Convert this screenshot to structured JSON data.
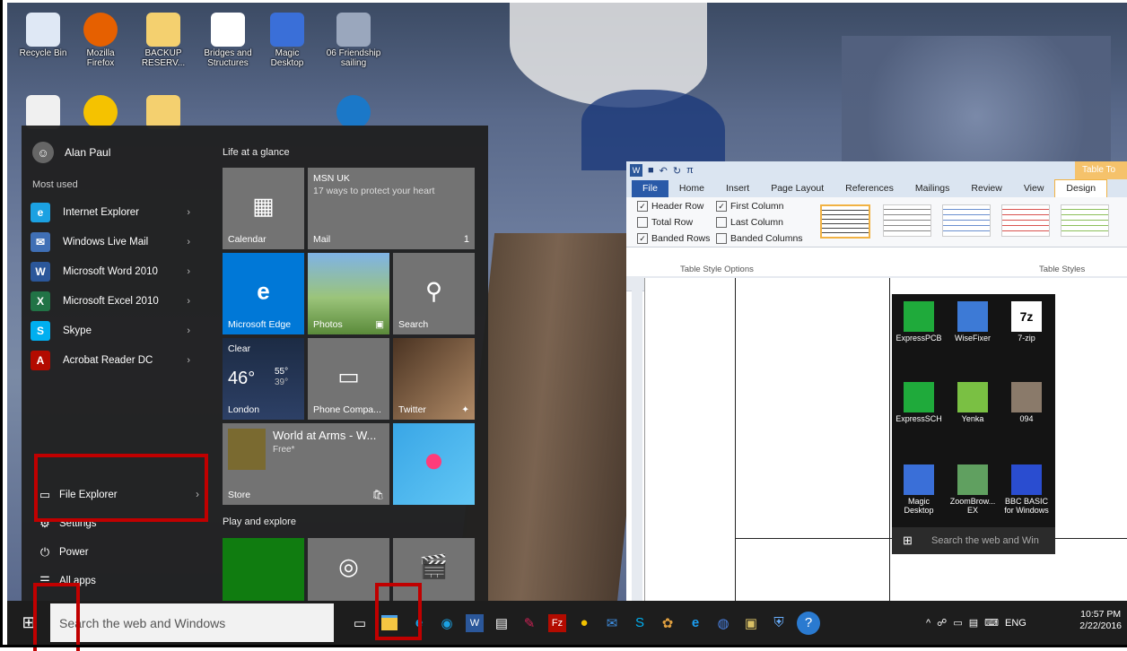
{
  "desktop": {
    "icons": [
      {
        "label": "Recycle Bin",
        "icon": "recycle-bin-icon",
        "color": "#dfe8f5"
      },
      {
        "label": "Mozilla Firefox",
        "icon": "firefox-icon",
        "color": "#e66000"
      },
      {
        "label": "BACKUP RESERV...",
        "icon": "folder-icon",
        "color": "#f4d06f"
      },
      {
        "label": "Bridges and Structures",
        "icon": "document-icon",
        "color": "#ffffff"
      },
      {
        "label": "Magic Desktop",
        "icon": "magic-desktop-icon",
        "color": "#3a6fd8"
      },
      {
        "label": "06 Friendship sailing",
        "icon": "photo-icon",
        "color": "#9aa7bd"
      }
    ]
  },
  "start_menu": {
    "user_name": "Alan Paul",
    "most_used_label": "Most used",
    "apps": [
      {
        "label": "Internet Explorer",
        "icon": "ie-icon",
        "glyph": "e",
        "color": "#1ba1e2"
      },
      {
        "label": "Windows Live Mail",
        "icon": "mail-icon",
        "glyph": "✉",
        "color": "#3f6fb5"
      },
      {
        "label": "Microsoft Word 2010",
        "icon": "word-icon",
        "glyph": "W",
        "color": "#2b579a"
      },
      {
        "label": "Microsoft Excel 2010",
        "icon": "excel-icon",
        "glyph": "X",
        "color": "#217346"
      },
      {
        "label": "Skype",
        "icon": "skype-icon",
        "glyph": "S",
        "color": "#00aff0"
      },
      {
        "label": "Acrobat Reader DC",
        "icon": "acrobat-icon",
        "glyph": "A",
        "color": "#b30b00"
      }
    ],
    "bottom": {
      "file_explorer": "File Explorer",
      "settings": "Settings",
      "power": "Power",
      "all_apps": "All apps"
    },
    "life_title": "Life at a glance",
    "play_title": "Play and explore",
    "tiles": {
      "calendar": "Calendar",
      "mail": "Mail",
      "mail_count": "1",
      "msn_title": "MSN UK",
      "msn_sub": "17 ways to protect your heart",
      "edge": "Microsoft Edge",
      "photos": "Photos",
      "search": "Search",
      "weather_cond": "Clear",
      "weather_temp": "46°",
      "weather_hi": "55°",
      "weather_lo": "39°",
      "weather_city": "London",
      "phone": "Phone Compa...",
      "twitter": "Twitter",
      "game_title": "World at Arms - W...",
      "game_sub": "Free*",
      "store": "Store"
    }
  },
  "word": {
    "contextual_tab": "Table To",
    "tabs": [
      "File",
      "Home",
      "Insert",
      "Page Layout",
      "References",
      "Mailings",
      "Review",
      "View",
      "Design"
    ],
    "options": {
      "header_row": "Header Row",
      "first_column": "First Column",
      "total_row": "Total Row",
      "last_column": "Last Column",
      "banded_rows": "Banded Rows",
      "banded_columns": "Banded Columns"
    },
    "group_options": "Table Style Options",
    "group_styles": "Table Styles",
    "doc_icons": [
      {
        "label": "ExpressPCB",
        "icon": "expresspcb-icon"
      },
      {
        "label": "WiseFixer",
        "icon": "wisefixer-icon"
      },
      {
        "label": "7-zip",
        "icon": "7zip-icon"
      },
      {
        "label": "ExpressSCH",
        "icon": "expresssch-icon"
      },
      {
        "label": "Yenka",
        "icon": "yenka-icon"
      },
      {
        "label": "094",
        "icon": "photo-icon"
      },
      {
        "label": "Magic Desktop",
        "icon": "magic-desktop-icon"
      },
      {
        "label": "ZoomBrow... EX",
        "icon": "zoombrowser-icon"
      },
      {
        "label": "BBC BASIC for Windows",
        "icon": "bbc-basic-icon"
      }
    ],
    "doc_search": "Search the web and Win"
  },
  "taskbar": {
    "search_placeholder": "Search the web and Windows",
    "language": "ENG",
    "time": "10:57 PM",
    "date": "2/22/2016"
  },
  "colors": {
    "highlight_box": "#c00000",
    "tile_blue": "#0078d7",
    "tile_gray": "#737373"
  }
}
